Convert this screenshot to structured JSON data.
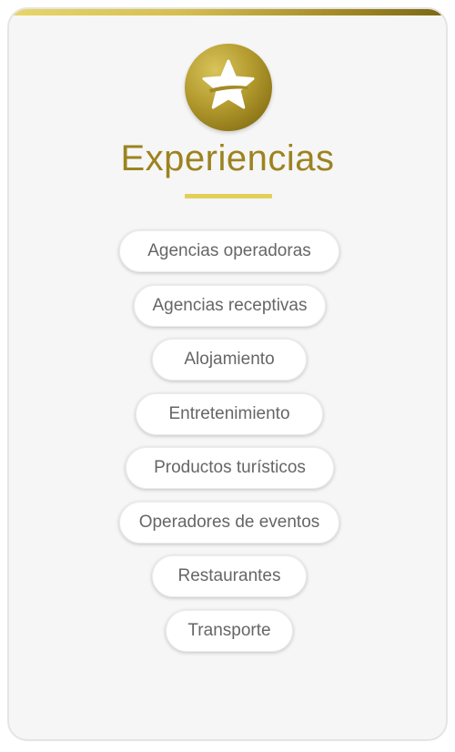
{
  "header": {
    "title": "Experiencias",
    "icon": "star-icon"
  },
  "colors": {
    "accent_gold": "#9c8320",
    "divider": "#e2cf5a",
    "pill_text": "#666666",
    "card_background": "#f6f6f6"
  },
  "menu": {
    "items": [
      {
        "label": "Agencias operadoras"
      },
      {
        "label": "Agencias receptivas"
      },
      {
        "label": "Alojamiento"
      },
      {
        "label": "Entretenimiento"
      },
      {
        "label": "Productos turísticos"
      },
      {
        "label": "Operadores de eventos"
      },
      {
        "label": "Restaurantes"
      },
      {
        "label": "Transporte"
      }
    ]
  }
}
